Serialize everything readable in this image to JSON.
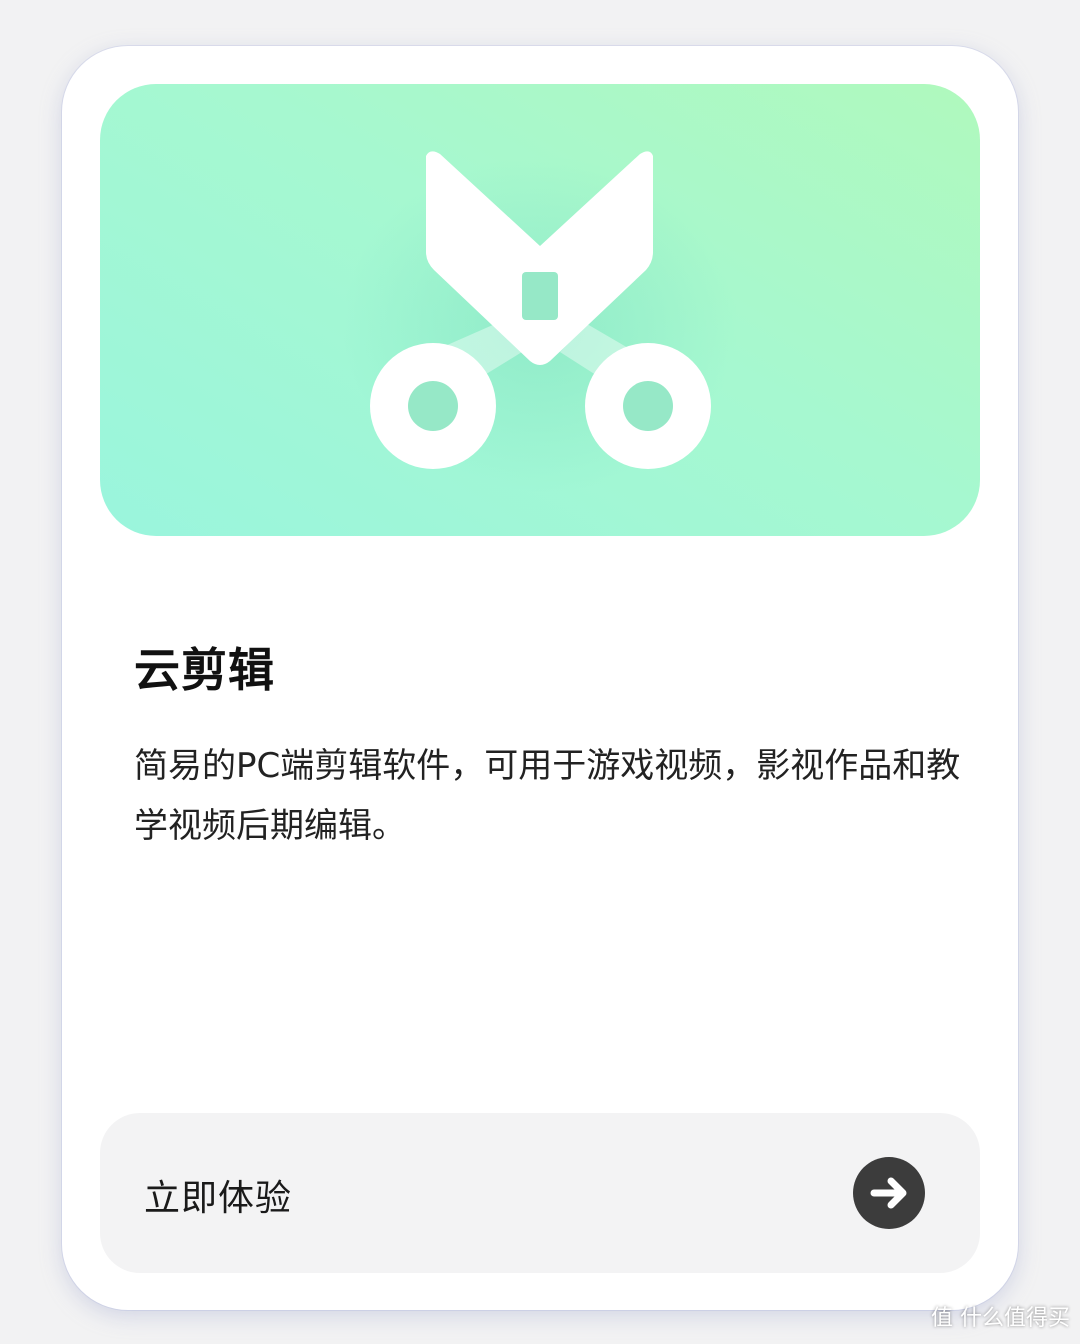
{
  "card": {
    "title": "云剪辑",
    "description": "简易的PC端剪辑软件，可用于游戏视频，影视作品和教学视频后期编辑。",
    "hero_icon": "scissors-icon",
    "hero_gradient": [
      "#9af5dd",
      "#b0f9bd"
    ],
    "cta": {
      "label": "立即体验",
      "icon": "arrow-right-icon",
      "icon_bg": "#3c3c3c"
    }
  },
  "watermark": {
    "text": "值 什么值得买"
  }
}
